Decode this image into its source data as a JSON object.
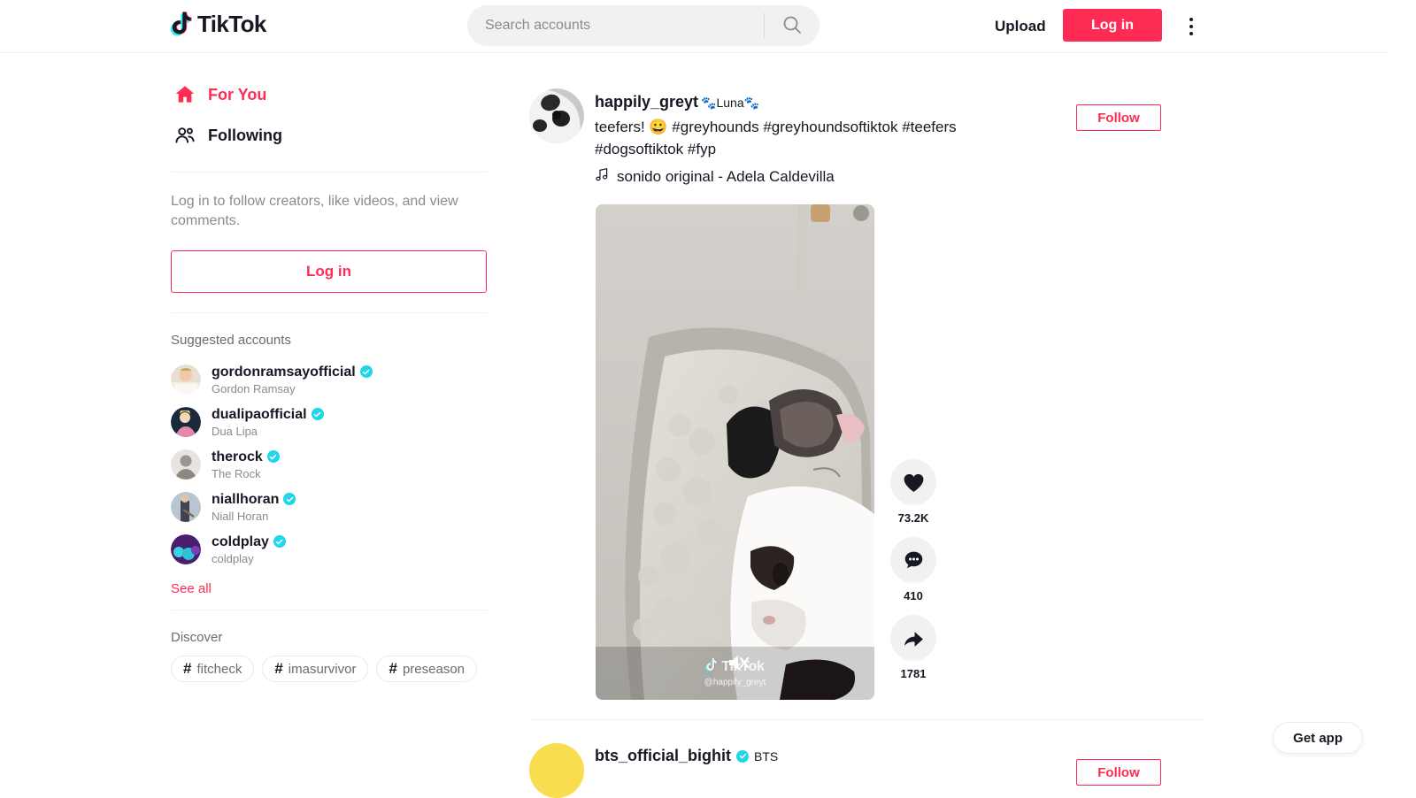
{
  "header": {
    "logo_text": "TikTok",
    "logo_icon": "tiktok-note-icon",
    "search": {
      "placeholder": "Search accounts",
      "value": "",
      "icon": "search-icon"
    },
    "upload_label": "Upload",
    "login_label": "Log in",
    "more_icon": "kebab-menu-icon"
  },
  "sidebar": {
    "nav": [
      {
        "label": "For You",
        "icon": "home-icon",
        "active": true
      },
      {
        "label": "Following",
        "icon": "people-icon",
        "active": false
      }
    ],
    "login_prompt": "Log in to follow creators, like videos, and view comments.",
    "login_button": "Log in",
    "suggested_title": "Suggested accounts",
    "suggested": [
      {
        "username": "gordonramsayofficial",
        "name": "Gordon Ramsay",
        "verified": true
      },
      {
        "username": "dualipaofficial",
        "name": "Dua Lipa",
        "verified": true
      },
      {
        "username": "therock",
        "name": "The Rock",
        "verified": true
      },
      {
        "username": "niallhoran",
        "name": "Niall Horan",
        "verified": true
      },
      {
        "username": "coldplay",
        "name": "coldplay",
        "verified": true
      }
    ],
    "see_all": "See all",
    "discover_title": "Discover",
    "tags": [
      "fitcheck",
      "imasurvivor",
      "preseason"
    ]
  },
  "feed": {
    "posts": [
      {
        "username": "happily_greyt",
        "nickname": "🐾Luna🐾",
        "caption": "teefers! 😀 #greyhounds #greyhoundsoftiktok #teefers #dogsoftiktok #fyp",
        "music": "sonido original - Adela Caldevilla",
        "music_icon": "music-note-icon",
        "follow_label": "Follow",
        "watermark_text": "TikTok",
        "watermark_handle": "@happily_greyt",
        "mute_icon": "speaker-muted-icon",
        "actions": [
          {
            "icon": "heart-icon",
            "count": "73.2K"
          },
          {
            "icon": "comment-icon",
            "count": "410"
          },
          {
            "icon": "share-icon",
            "count": "1781"
          }
        ]
      },
      {
        "username": "bts_official_bighit",
        "nickname": "BTS",
        "verified": true,
        "follow_label": "Follow"
      }
    ]
  },
  "get_app_label": "Get app",
  "colors": {
    "brand_red": "#fe2c55",
    "brand_cyan": "#25f4ee",
    "verified_blue": "#20d5ec",
    "text": "#161823",
    "muted": "#8a8b91",
    "divider": "#f1f1f2"
  }
}
